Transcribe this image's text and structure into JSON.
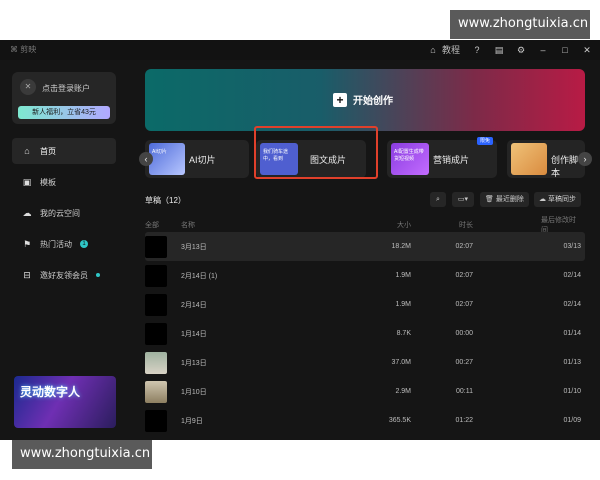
{
  "watermarks": {
    "top": "www.zhongtuixia.cn",
    "bottom": "www.zhongtuixia.cn"
  },
  "titlebar": {
    "app_name": "剪映",
    "tutorial": "教程"
  },
  "sidebar": {
    "login_label": "点击登录账户",
    "promo_label": "新人福利，立省43元",
    "items": [
      {
        "label": "首页",
        "icon": "home-icon",
        "active": true
      },
      {
        "label": "模板",
        "icon": "template-icon"
      },
      {
        "label": "我的云空间",
        "icon": "cloud-icon"
      },
      {
        "label": "热门活动",
        "icon": "flag-icon",
        "badge": "1"
      },
      {
        "label": "邀好友领会员",
        "icon": "gift-icon"
      }
    ],
    "banner_text": "灵动数字人"
  },
  "hero": {
    "label": "开始创作"
  },
  "tools": [
    {
      "label": "AI切片",
      "thumb": "AI切片"
    },
    {
      "label": "图文成片",
      "thumb": "我们骑车途中，看到"
    },
    {
      "label": "营销成片",
      "thumb": "AI配置生成带货短视频",
      "badge": "限免"
    },
    {
      "label": "创作脚本"
    }
  ],
  "drafts": {
    "title": "草稿（12）",
    "delete_label": "最近删除",
    "sync_label": "草稿同步"
  },
  "table": {
    "headers": {
      "all": "全部",
      "name": "名称",
      "size": "大小",
      "duration": "时长",
      "modified": "最后修改时间"
    },
    "rows": [
      {
        "name": "3月13日",
        "size": "18.2M",
        "duration": "02:07",
        "modified": "03/13"
      },
      {
        "name": "2月14日 (1)",
        "size": "1.9M",
        "duration": "02:07",
        "modified": "02/14"
      },
      {
        "name": "2月14日",
        "size": "1.9M",
        "duration": "02:07",
        "modified": "02/14"
      },
      {
        "name": "1月14日",
        "size": "8.7K",
        "duration": "00:00",
        "modified": "01/14"
      },
      {
        "name": "1月13日",
        "size": "37.0M",
        "duration": "00:27",
        "modified": "01/13"
      },
      {
        "name": "1月10日",
        "size": "2.9M",
        "duration": "00:11",
        "modified": "01/10"
      },
      {
        "name": "1月9日",
        "size": "365.5K",
        "duration": "01:22",
        "modified": "01/09"
      }
    ]
  }
}
